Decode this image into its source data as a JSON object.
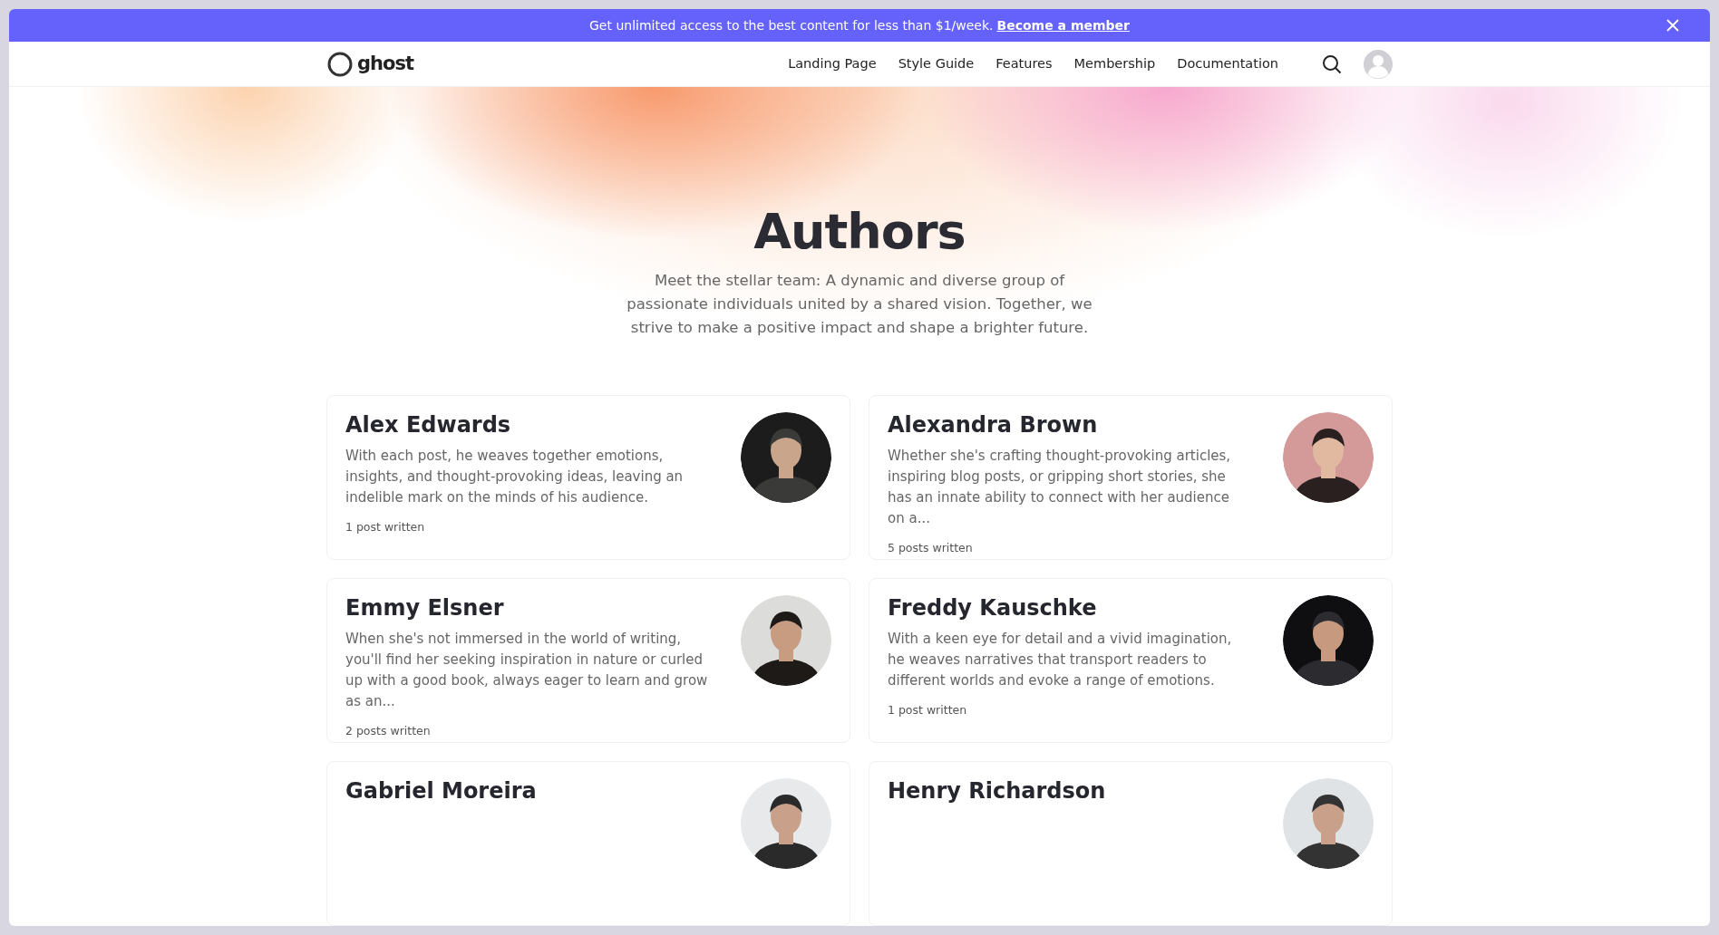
{
  "banner": {
    "text": "Get unlimited access to the best content for less than $1/week.",
    "link": "Become a member"
  },
  "navbar": {
    "logo": "ghost",
    "links": [
      {
        "label": "Landing Page"
      },
      {
        "label": "Style Guide"
      },
      {
        "label": "Features"
      },
      {
        "label": "Membership"
      },
      {
        "label": "Documentation"
      }
    ]
  },
  "hero": {
    "title": "Authors",
    "description": "Meet the stellar team: A dynamic and diverse group of passionate individuals united by a shared vision. Together, we strive to make a positive impact and shape a brighter future."
  },
  "authors": [
    {
      "name": "Alex Edwards",
      "bio": "With each post, he weaves together emotions, insights, and thought-provoking ideas, leaving an indelible mark on the minds of his audience.",
      "posts": "1 post written"
    },
    {
      "name": "Alexandra Brown",
      "bio": "Whether she's crafting thought-provoking articles, inspiring blog posts, or gripping short stories, she has an innate ability to connect with her audience on a...",
      "posts": "5 posts written"
    },
    {
      "name": "Emmy Elsner",
      "bio": "When she's not immersed in the world of writing, you'll find her seeking inspiration in nature or curled up with a good book, always eager to learn and grow as an...",
      "posts": "2 posts written"
    },
    {
      "name": "Freddy Kauschke",
      "bio": "With a keen eye for detail and a vivid imagination, he weaves narratives that transport readers to different worlds and evoke a range of emotions.",
      "posts": "1 post written"
    },
    {
      "name": "Gabriel Moreira"
    },
    {
      "name": "Henry Richardson"
    }
  ]
}
